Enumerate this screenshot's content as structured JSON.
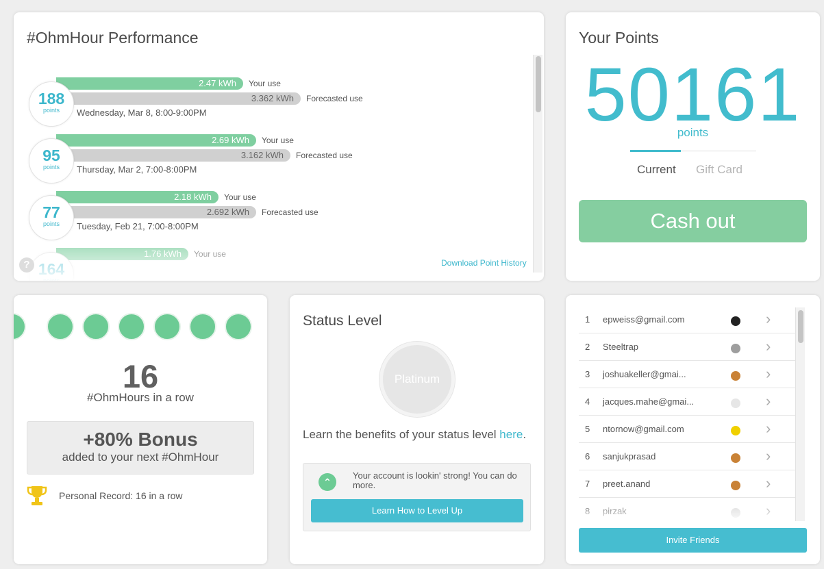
{
  "performance": {
    "title": "#OhmHour Performance",
    "events": [
      {
        "points": "188",
        "points_word": "points",
        "use_value": "2.47 kWh",
        "use_label": "Your use",
        "use_fraction": 0.65,
        "forecast_value": "3.362 kWh",
        "forecast_label": "Forecasted use",
        "forecast_fraction": 0.85,
        "date": "Wednesday, Mar 8, 8:00-9:00PM"
      },
      {
        "points": "95",
        "points_word": "points",
        "use_value": "2.69 kWh",
        "use_label": "Your use",
        "use_fraction": 0.695,
        "forecast_value": "3.162 kWh",
        "forecast_label": "Forecasted use",
        "forecast_fraction": 0.815,
        "date": "Thursday, Mar 2, 7:00-8:00PM"
      },
      {
        "points": "77",
        "points_word": "points",
        "use_value": "2.18 kWh",
        "use_label": "Your use",
        "use_fraction": 0.565,
        "forecast_value": "2.692 kWh",
        "forecast_label": "Forecasted use",
        "forecast_fraction": 0.695,
        "date": "Tuesday, Feb 21, 7:00-8:00PM"
      },
      {
        "points": "164",
        "points_word": "points",
        "use_value": "1.76 kWh",
        "use_label": "Your use",
        "use_fraction": 0.46,
        "forecast_value": "",
        "forecast_label": "",
        "forecast_fraction": 0.0,
        "date": ""
      }
    ],
    "help": "?",
    "download_link": "Download Point History"
  },
  "points": {
    "title": "Your Points",
    "value": "50161",
    "unit": "points",
    "tabs": {
      "current": "Current",
      "gift_card": "Gift Card"
    },
    "cashout_label": "Cash out"
  },
  "streak": {
    "filled_dots": 7,
    "count": "16",
    "label": "#OhmHours in a row",
    "bonus_title": "+80% Bonus",
    "bonus_sub": "added to your next #OhmHour",
    "record": "Personal Record: 16 in a row"
  },
  "status": {
    "title": "Status Level",
    "level": "Platinum",
    "learn_text": "Learn the benefits of your status level ",
    "learn_link": "here",
    "learn_end": ".",
    "tip": "Your account is lookin' strong! You can do more.",
    "level_up_label": "Learn How to Level Up"
  },
  "friends": {
    "rows": [
      {
        "rank": "1",
        "name": "epweiss@gmail.com",
        "color": "#222222"
      },
      {
        "rank": "2",
        "name": "Steeltrap",
        "color": "#9e9e9e"
      },
      {
        "rank": "3",
        "name": "joshuakeller@gmai...",
        "color": "#c98236"
      },
      {
        "rank": "4",
        "name": "jacques.mahe@gmai...",
        "color": "#e6e6e6"
      },
      {
        "rank": "5",
        "name": "ntornow@gmail.com",
        "color": "#f0d000"
      },
      {
        "rank": "6",
        "name": "sanjukprasad",
        "color": "#c98236"
      },
      {
        "rank": "7",
        "name": "preet.anand",
        "color": "#c98236"
      },
      {
        "rank": "8",
        "name": "pirzak",
        "color": "#d8d8d8"
      }
    ],
    "invite_label": "Invite Friends"
  },
  "colors": {
    "accent_blue": "#42bccd",
    "green": "#85cea0",
    "grey_bar": "#d0d0d0"
  }
}
